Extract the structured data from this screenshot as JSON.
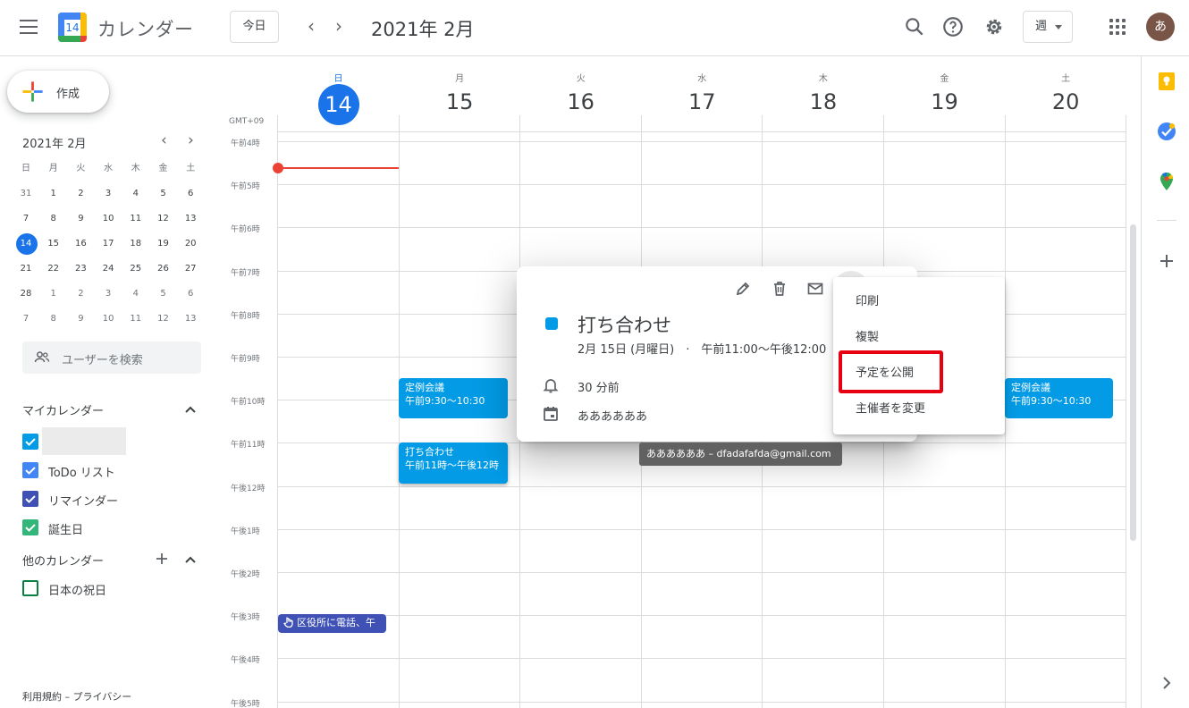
{
  "header": {
    "app_name": "カレンダー",
    "logo_number": "14",
    "today_label": "今日",
    "current_date": "2021年 2月",
    "view_label": "週",
    "avatar_initial": "あ",
    "prev_glyph": "‹",
    "next_glyph": "›"
  },
  "sidebar": {
    "create_label": "作成",
    "mini_calendar": {
      "title": "2021年 2月",
      "prev_glyph": "‹",
      "next_glyph": "›",
      "weekdays": [
        "日",
        "月",
        "火",
        "水",
        "木",
        "金",
        "土"
      ],
      "weeks": [
        [
          "31",
          "1",
          "2",
          "3",
          "4",
          "5",
          "6"
        ],
        [
          "7",
          "8",
          "9",
          "10",
          "11",
          "12",
          "13"
        ],
        [
          "14",
          "15",
          "16",
          "17",
          "18",
          "19",
          "20"
        ],
        [
          "21",
          "22",
          "23",
          "24",
          "25",
          "26",
          "27"
        ],
        [
          "28",
          "1",
          "2",
          "3",
          "4",
          "5",
          "6"
        ],
        [
          "7",
          "8",
          "9",
          "10",
          "11",
          "12",
          "13"
        ]
      ],
      "today": "14"
    },
    "people_search_placeholder": "ユーザーを検索",
    "my_calendars_title": "マイカレンダー",
    "my_calendars": [
      {
        "label": "",
        "color": "#039be5"
      },
      {
        "label": "ToDo リスト",
        "color": "#4285f4"
      },
      {
        "label": "リマインダー",
        "color": "#3f51b5"
      },
      {
        "label": "誕生日",
        "color": "#33b679"
      }
    ],
    "other_calendars_title": "他のカレンダー",
    "other_calendars": [
      {
        "label": "日本の祝日",
        "color": "#0b8043"
      }
    ],
    "footer": "利用規約 – プライバシー"
  },
  "week": {
    "timezone": "GMT+09",
    "days": [
      {
        "dow": "日",
        "num": "14"
      },
      {
        "dow": "月",
        "num": "15"
      },
      {
        "dow": "火",
        "num": "16"
      },
      {
        "dow": "水",
        "num": "17"
      },
      {
        "dow": "木",
        "num": "18"
      },
      {
        "dow": "金",
        "num": "19"
      },
      {
        "dow": "土",
        "num": "20"
      }
    ],
    "hours": [
      "午前4時",
      "午前5時",
      "午前6時",
      "午前7時",
      "午前8時",
      "午前9時",
      "午前10時",
      "午前11時",
      "午後12時",
      "午後1時",
      "午後2時",
      "午後3時",
      "午後4時",
      "午後5時"
    ]
  },
  "events": {
    "monday_meeting": {
      "title": "定例会議",
      "time": "午前9:30～10:30",
      "color": "#039be5"
    },
    "saturday_meeting": {
      "title": "定例会議",
      "time": "午前9:30～10:30",
      "color": "#039be5"
    },
    "uchiawase": {
      "title": "打ち合わせ",
      "time": "午前11時～午後12時",
      "color": "#039be5"
    },
    "reminder": {
      "title": "区役所に電話、午",
      "color": "#3f51b5"
    }
  },
  "popup": {
    "title": "打ち合わせ",
    "when": "2月 15日 (月曜日)　·　午前11:00～午後12:00",
    "notification": "30 分前",
    "calendar": "ああああああ"
  },
  "tooltip": "ああああああ – dfadafafda@gmail.com",
  "menu": {
    "items": [
      "印刷",
      "複製",
      "予定を公開",
      "主催者を変更"
    ]
  }
}
